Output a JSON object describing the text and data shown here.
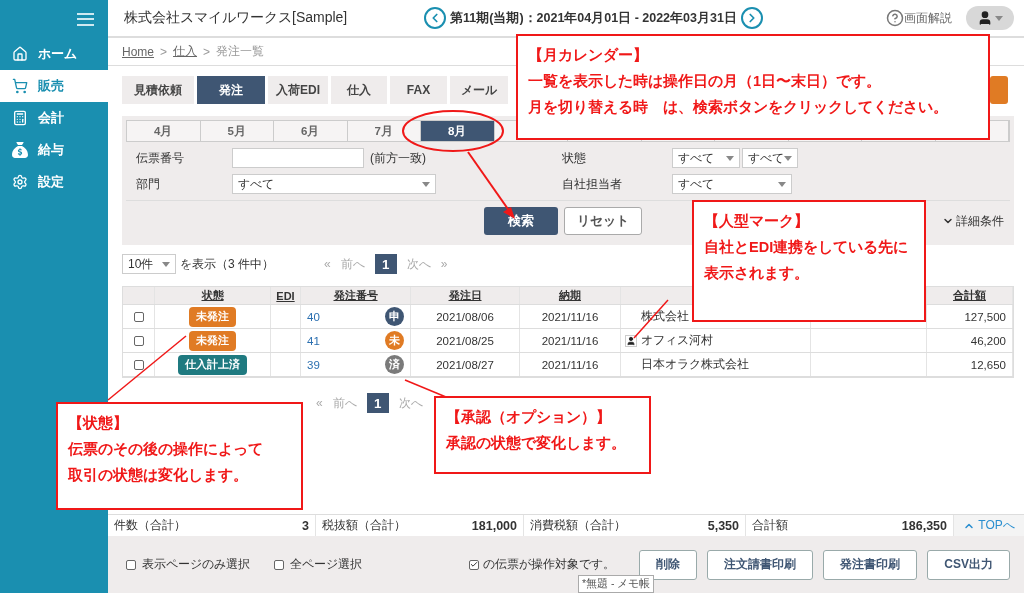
{
  "sidebar": {
    "items": [
      {
        "label": "ホーム",
        "selected": false
      },
      {
        "label": "販売",
        "selected": true
      },
      {
        "label": "会計",
        "selected": false
      },
      {
        "label": "給与",
        "selected": false
      },
      {
        "label": "設定",
        "selected": false
      }
    ]
  },
  "header": {
    "company": "株式会社スマイルワークス[Sample]",
    "period": "第11期(当期)：2021年04月01日 - 2022年03月31日",
    "help": "画面解説"
  },
  "breadcrumb": {
    "separator": ">",
    "items": [
      {
        "label": "Home",
        "link": true
      },
      {
        "label": "仕入",
        "link": true
      },
      {
        "label": "発注一覧",
        "link": false
      }
    ]
  },
  "tabs": [
    {
      "label": "見積依頼",
      "selected": false
    },
    {
      "label": "発注",
      "selected": true
    },
    {
      "label": "入荷EDI",
      "selected": false
    },
    {
      "label": "仕入",
      "selected": false
    },
    {
      "label": "FAX",
      "selected": false
    },
    {
      "label": "メール",
      "selected": false
    }
  ],
  "months": [
    {
      "label": "4月",
      "selected": false
    },
    {
      "label": "5月",
      "selected": false
    },
    {
      "label": "6月",
      "selected": false
    },
    {
      "label": "7月",
      "selected": false
    },
    {
      "label": "8月",
      "selected": true
    }
  ],
  "filters": {
    "slip_no": {
      "label": "伝票番号",
      "note": "(前方一致)"
    },
    "status": {
      "label": "状態",
      "values": [
        "すべて",
        "すべて"
      ]
    },
    "department": {
      "label": "部門",
      "value": "すべて"
    },
    "staff": {
      "label": "自社担当者",
      "value": "すべて"
    }
  },
  "search_buttons": {
    "search": "検索",
    "reset": "リセット",
    "details": "詳細条件"
  },
  "pager": {
    "per_page": "10件",
    "summary": "を表示（3 件中）",
    "first": "«",
    "prev": "前へ",
    "page": "1",
    "next": "次へ",
    "last": "»"
  },
  "table": {
    "columns": [
      "状態",
      "EDI",
      "発注番号",
      "発注日",
      "納期",
      "合計額"
    ],
    "rows": [
      {
        "checked": false,
        "status": {
          "label": "未発注",
          "color": "#e07b24"
        },
        "number": "40",
        "approval": {
          "label": "申",
          "color": "#3f5673"
        },
        "order_date": "2021/08/06",
        "due_date": "2021/11/16",
        "partner": "株式会社",
        "edi_partner": false,
        "total": "127,500"
      },
      {
        "checked": false,
        "status": {
          "label": "未発注",
          "color": "#e07b24"
        },
        "number": "41",
        "approval": {
          "label": "未",
          "color": "#e07b24"
        },
        "order_date": "2021/08/25",
        "due_date": "2021/11/16",
        "partner": "オフィス河村",
        "edi_partner": true,
        "total": "46,200"
      },
      {
        "checked": false,
        "status": {
          "label": "仕入計上済",
          "color": "#1f7a80"
        },
        "number": "39",
        "approval": {
          "label": "済",
          "color": "#7a7a7a"
        },
        "order_date": "2021/08/27",
        "due_date": "2021/11/16",
        "partner": "日本オラク株式会社",
        "edi_partner": false,
        "total": "12,650"
      }
    ]
  },
  "bottom_pager": {
    "first": "«",
    "prev": "前へ",
    "page": "1",
    "next": "次へ"
  },
  "summary": [
    {
      "label": "件数（合計）",
      "value": "3"
    },
    {
      "label": "税抜額（合計）",
      "value": "181,000"
    },
    {
      "label": "消費税額（合計）",
      "value": "5,350"
    },
    {
      "label": "合計額",
      "value": "186,350"
    }
  ],
  "top_link": "TOPへ",
  "selection": [
    {
      "label": "表示ページのみ選択",
      "checked": false
    },
    {
      "label": "全ページ選択",
      "checked": false
    }
  ],
  "target_note": {
    "checked": true,
    "text": "の伝票が操作対象です。"
  },
  "actions": [
    "削除",
    "注文請書印刷",
    "発注書印刷",
    "CSV出力"
  ],
  "tooltip": "*無題 - メモ帳",
  "callouts": [
    {
      "title": "【月カレンダー】",
      "lines": [
        "一覧を表示した時は操作日の月（1日〜末日）です。",
        "月を切り替える時　は、検索ボタンをクリックしてください。"
      ]
    },
    {
      "title": "【人型マーク】",
      "lines": [
        "自社とEDI連携をしている先に",
        "表示されます。"
      ]
    },
    {
      "title": "【状態】",
      "lines": [
        "伝票のその後の操作によって",
        "取引の状態は変化します。"
      ]
    },
    {
      "title": "【承認（オプション）】",
      "lines": [
        "承認の状態で変化します。"
      ]
    }
  ]
}
